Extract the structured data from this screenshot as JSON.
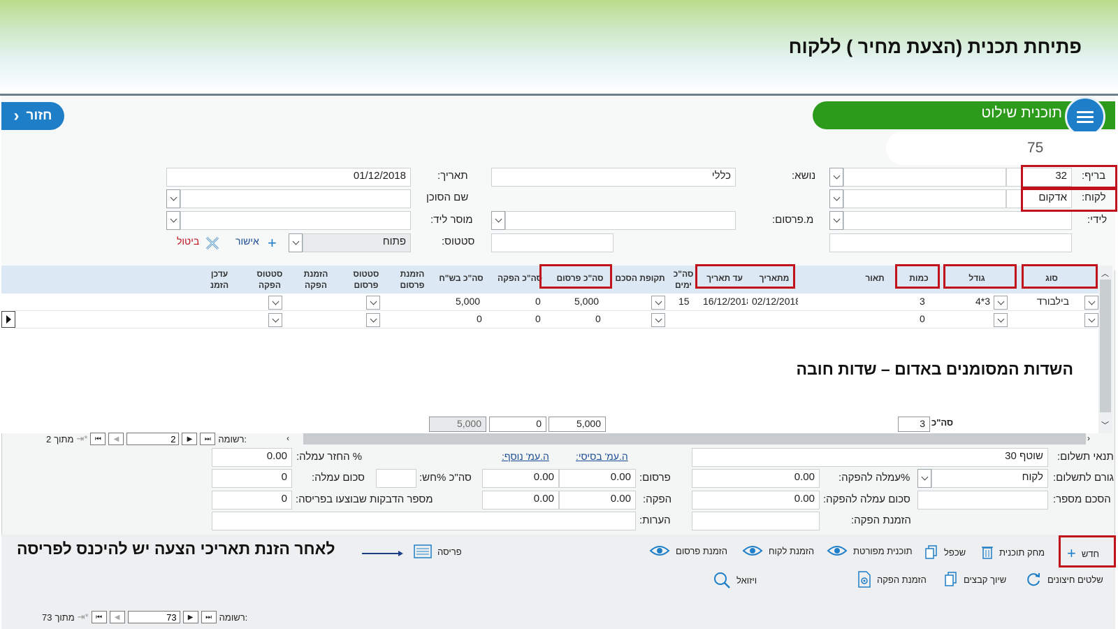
{
  "slide": {
    "title": "פתיחת תכנית (הצעת מחיר ) ללקוח",
    "note_required": "השדות המסומנים באדום – שדות חובה",
    "note_print": "לאחר הזנת תאריכי הצעה יש להיכנס לפריסה"
  },
  "header": {
    "back_label": "חזור",
    "plan_title": "תוכנית שילוט",
    "plan_number": "75"
  },
  "form": {
    "brief_label": "בריף:",
    "brief_value": "32",
    "client_label": "לקוח:",
    "client_value": "אדקום",
    "lidi_label": "לידי:",
    "lidi_value": "",
    "subject_label": "נושא:",
    "subject_value": "כללי",
    "media_label": "מ.פרסום:",
    "media_value": "",
    "date_label": "תאריך:",
    "date_value": "01/12/2018",
    "agent_label": "שם הסוכן",
    "agent_value": "",
    "lead_label": "מוסר ליד:",
    "lead_value": "",
    "status_label": "סטטוס:",
    "status_value": "פתוח",
    "approve_label": "אישור",
    "cancel_label": "ביטול"
  },
  "grid": {
    "headers": {
      "type": "סוג",
      "size": "גודל",
      "qty": "כמות",
      "desc": "תאור",
      "from_date": "מתאריך",
      "to_date": "עד תאריך",
      "days_line1": "סה\"כ",
      "days_line2": "ימים",
      "period": "תקופת הסכם",
      "total_pub": "סה\"כ פרסום",
      "total_prod": "סה\"כ הפקה",
      "total_nis": "סה\"כ בש\"ח",
      "order_pub_line1": "הזמנת",
      "order_pub_line2": "פרסום",
      "status_pub_line1": "סטטוס",
      "status_pub_line2": "פרסום",
      "order_prod_line1": "הזמנת",
      "order_prod_line2": "הפקה",
      "status_prod_line1": "סטטוס",
      "status_prod_line2": "הפקה",
      "update_line1": "עדכן",
      "update_line2": "הזמנ"
    },
    "rows": [
      {
        "type": "בילבורד",
        "size": "4*3",
        "qty": "3",
        "from_date": "02/12/2018",
        "to_date": "16/12/2018",
        "days": "15",
        "total_pub": "5,000",
        "total_prod": "0",
        "total_nis": "5,000"
      },
      {
        "type": "",
        "size": "",
        "qty": "0",
        "from_date": "",
        "to_date": "",
        "days": "",
        "total_pub": "0",
        "total_prod": "0",
        "total_nis": "0"
      }
    ],
    "totals_label": "סה\"כ",
    "totals": {
      "qty": "3",
      "pub": "5,000",
      "prod": "0",
      "nis": "5,000"
    },
    "nav": {
      "record_label": "רשומה:",
      "current": "2",
      "of_label": "מתוך",
      "total": "2"
    }
  },
  "summary": {
    "payment_terms_label": "תנאי תשלום:",
    "payment_terms_value": "שוטף 30",
    "payer_label": "גורם לתשלום:",
    "payer_value": "לקוח",
    "agreement_label": "הסכם מספר:",
    "agreement_value": "",
    "prod_comm_pct_label": "%עמלה להפקה:",
    "prod_comm_pct_value": "0.00",
    "prod_comm_sum_label": "סכום עמלה להפקה:",
    "prod_comm_sum_value": "0.00",
    "prod_order_label": "הזמנת הפקה:",
    "prod_order_value": "",
    "base_price_label": "ה.עמ' בסיסי:",
    "extra_price_label": "ה.עמ' נוסף:",
    "pub_label": "פרסום:",
    "pub_base": "0.00",
    "pub_extra": "0.00",
    "prod_label": "הפקה:",
    "prod_base": "0.00",
    "prod_extra": "0.00",
    "notes_label": "הערות:",
    "return_comm_label": "% החזר עמלה:",
    "return_comm_value": "0.00",
    "total_vat_label": "סה\"כ %חש:",
    "total_vat_value": "",
    "comm_sum_label": "סכום עמלה:",
    "comm_sum_value": "0",
    "stickers_label": "מספר הדבקות שבוצעו בפריסה:",
    "stickers_value": "0"
  },
  "toolbar": {
    "new": "חדש",
    "delete_plan": "מחק תוכנית",
    "duplicate": "שכפל",
    "detailed_plan": "תוכנית מפורטת",
    "client_order": "הזמנת לקוח",
    "pub_order": "הזמנת פרסום",
    "layout": "פריסה",
    "external_signs": "שלטים חיצונים",
    "attach_files": "שיוך קבצים",
    "prod_order": "הזמנת הפקה",
    "visual": "ויזואל"
  },
  "bottom_nav": {
    "record_label": "רשומה:",
    "current": "73",
    "of_label": "מתוך",
    "total": "73"
  },
  "colors": {
    "accent_blue": "#1e7fc8",
    "green_bar": "#2c9a1b",
    "required_red": "#c1121c"
  }
}
